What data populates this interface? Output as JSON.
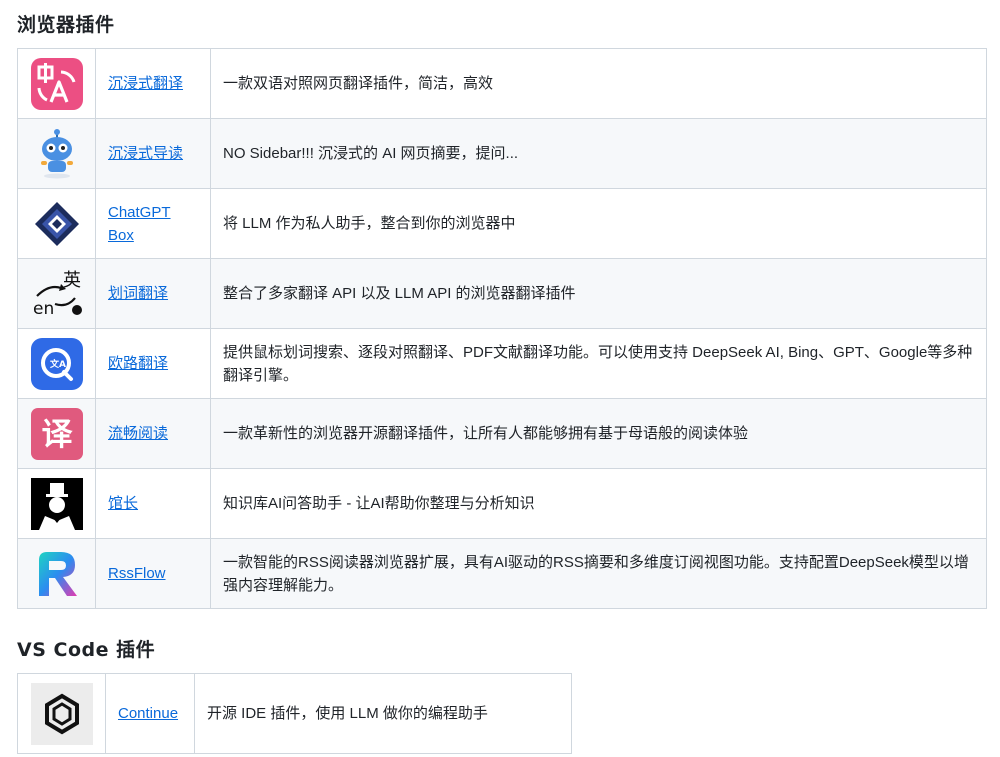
{
  "sections": [
    {
      "title": "浏览器插件",
      "rows": [
        {
          "name": "沉浸式翻译",
          "desc": "一款双语对照网页翻译插件，简洁，高效",
          "icon": "immersive-translate-logo-icon"
        },
        {
          "name": "沉浸式导读",
          "desc": "NO Sidebar!!! 沉浸式的 AI 网页摘要，提问...",
          "icon": "robot-mascot-icon"
        },
        {
          "name": "ChatGPT Box",
          "desc": "将 LLM 作为私人助手，整合到你的浏览器中",
          "icon": "chatgpt-box-logo-icon"
        },
        {
          "name": "划词翻译",
          "desc": "整合了多家翻译 API 以及 LLM API 的浏览器翻译插件",
          "icon": "en-to-chinese-translate-icon"
        },
        {
          "name": "欧路翻译",
          "desc": "提供鼠标划词搜索、逐段对照翻译、PDF文献翻译功能。可以使用支持 DeepSeek AI, Bing、GPT、Google等多种翻译引擎。",
          "icon": "eudic-translate-logo-icon"
        },
        {
          "name": "流畅阅读",
          "desc": "一款革新性的浏览器开源翻译插件，让所有人都能够拥有基于母语般的阅读体验",
          "icon": "fluent-read-logo-icon",
          "icon_text": "译"
        },
        {
          "name": "馆长",
          "desc": "知识库AI问答助手 - 让AI帮助你整理与分析知识",
          "icon": "curator-gentleman-logo-icon"
        },
        {
          "name": "RssFlow",
          "desc": "一款智能的RSS阅读器浏览器扩展，具有AI驱动的RSS摘要和多维度订阅视图功能。支持配置DeepSeek模型以增强内容理解能力。",
          "icon": "rssflow-logo-icon"
        }
      ]
    },
    {
      "title": "VS Code 插件",
      "rows": [
        {
          "name": "Continue",
          "desc": "开源 IDE 插件，使用 LLM 做你的编程助手",
          "icon": "continue-logo-icon"
        }
      ]
    }
  ],
  "colors": {
    "link": "#0969da",
    "border": "#d0d7de",
    "row_alt": "#f6f8fa",
    "text": "#1f2328"
  }
}
